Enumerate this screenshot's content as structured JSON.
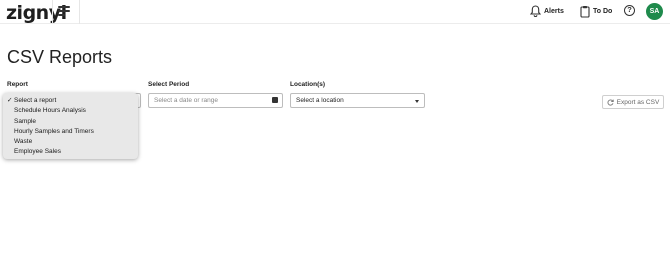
{
  "header": {
    "logo_text": "zignyl",
    "alerts_label": "Alerts",
    "todo_label": "To Do",
    "help_symbol": "?",
    "avatar_initials": "SA",
    "avatar_color": "#1f8a4c"
  },
  "page": {
    "title": "CSV Reports"
  },
  "filters": {
    "report_label": "Report",
    "period_label": "Select Period",
    "period_placeholder": "Select a date or range",
    "location_label": "Location(s)",
    "location_value": "Select a location"
  },
  "report_dropdown": {
    "selected_mark": "✓",
    "options": [
      "Select a report",
      "Schedule Hours Analysis",
      "Sample",
      "Hourly Samples and Timers",
      "Waste",
      "Employee Sales"
    ]
  },
  "actions": {
    "export_label": "Export as CSV"
  },
  "icons": {
    "menu": "hamburger-menu-icon",
    "alerts": "bell-icon",
    "todo": "clipboard-icon",
    "help": "question-circle-icon",
    "calendar": "calendar-icon",
    "export": "refresh-icon",
    "caret": "caret-down-icon"
  }
}
